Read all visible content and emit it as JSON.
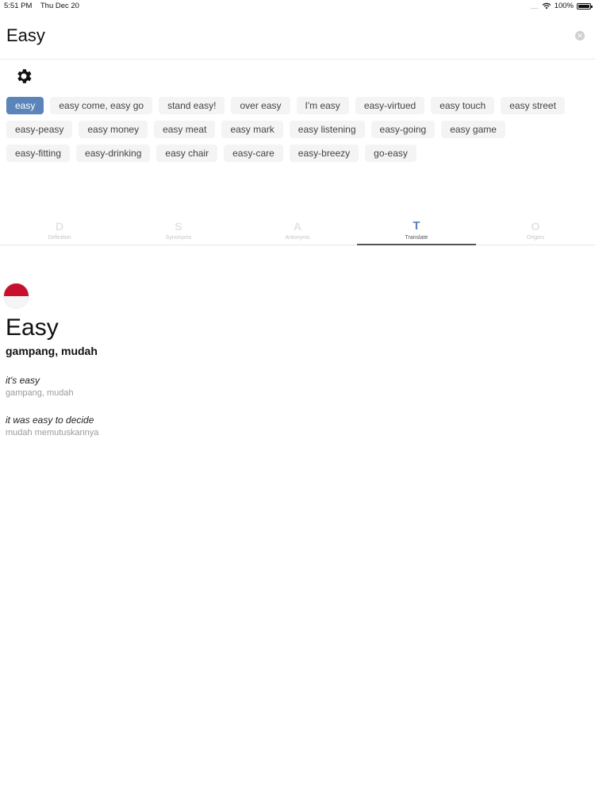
{
  "status_bar": {
    "time": "5:51 PM",
    "date": "Thu Dec 20",
    "signal": "....",
    "battery": "100%"
  },
  "search": {
    "value": "Easy",
    "clear_icon": "clear-icon"
  },
  "settings": {
    "icon": "gear-icon"
  },
  "chips": [
    {
      "label": "easy",
      "active": true
    },
    {
      "label": "easy come, easy go"
    },
    {
      "label": "stand easy!"
    },
    {
      "label": "over easy"
    },
    {
      "label": "I'm easy"
    },
    {
      "label": "easy-virtued"
    },
    {
      "label": "easy touch"
    },
    {
      "label": "easy street"
    },
    {
      "label": "easy-peasy"
    },
    {
      "label": "easy money"
    },
    {
      "label": "easy meat"
    },
    {
      "label": "easy mark"
    },
    {
      "label": "easy listening"
    },
    {
      "label": "easy-going"
    },
    {
      "label": "easy game"
    },
    {
      "label": "easy-fitting"
    },
    {
      "label": "easy-drinking"
    },
    {
      "label": "easy chair"
    },
    {
      "label": "easy-care"
    },
    {
      "label": "easy-breezy"
    },
    {
      "label": "go-easy"
    }
  ],
  "tabs": [
    {
      "label": "Definition",
      "icon": "D"
    },
    {
      "label": "Synonyms",
      "icon": "S"
    },
    {
      "label": "Antonyms",
      "icon": "A"
    },
    {
      "label": "Translate",
      "icon": "T",
      "active": true
    },
    {
      "label": "Origins",
      "icon": "O"
    }
  ],
  "translation": {
    "flag": "indonesia-flag-icon",
    "word": "Easy",
    "meaning": "gampang, mudah",
    "examples": [
      {
        "phrase": "it's easy",
        "translation": "gampang, mudah"
      },
      {
        "phrase": "it was easy to decide",
        "translation": "mudah memutuskannya"
      }
    ]
  },
  "colors": {
    "accent": "#5b84ba",
    "chip_bg": "#f4f4f4",
    "flag_red": "#c8102e"
  }
}
